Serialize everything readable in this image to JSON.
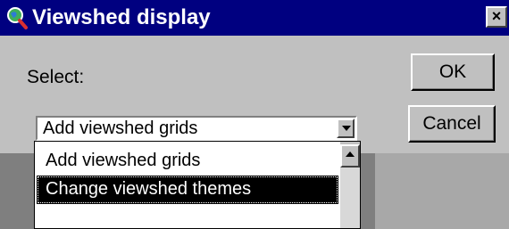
{
  "window": {
    "title": "Viewshed display",
    "close_label": "×",
    "icon": "magnifier-globe-icon"
  },
  "dialog": {
    "select_label": "Select:",
    "ok_label": "OK",
    "cancel_label": "Cancel"
  },
  "combo": {
    "value": "Add viewshed grids",
    "arrow_icon": "chevron-down-icon"
  },
  "dropdown": {
    "items": [
      {
        "label": "Add viewshed grids",
        "selected": false
      },
      {
        "label": "Change viewshed themes",
        "selected": true
      }
    ],
    "scroll_up_icon": "scroll-up-arrow-icon"
  },
  "colors": {
    "titlebar": "#000080",
    "face": "#c0c0c0",
    "selection": "#000000"
  }
}
